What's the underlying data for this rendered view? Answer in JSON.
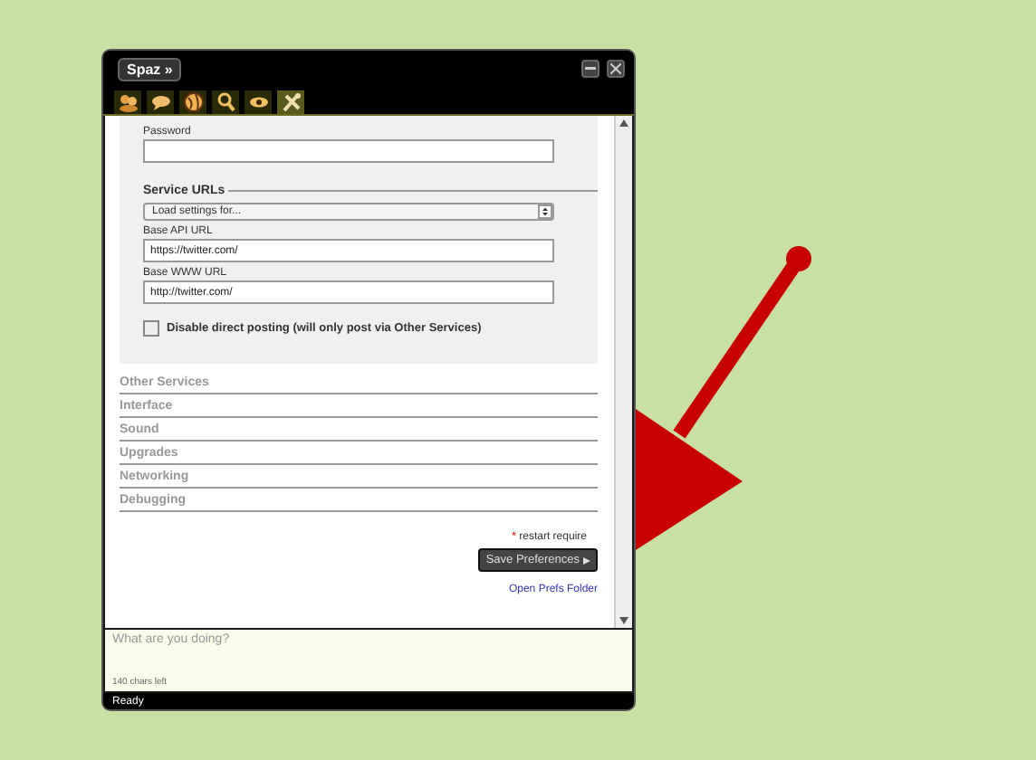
{
  "window": {
    "title": "Spaz »"
  },
  "tabs": [
    {
      "kind": "friends",
      "selected": false
    },
    {
      "kind": "replies",
      "selected": false
    },
    {
      "kind": "public",
      "selected": false
    },
    {
      "kind": "search",
      "selected": false
    },
    {
      "kind": "watch",
      "selected": false
    },
    {
      "kind": "settings",
      "selected": true
    }
  ],
  "account": {
    "password_label": "Password"
  },
  "service_urls": {
    "heading": "Service URLs",
    "select": "Load settings for...",
    "fields": [
      {
        "label": "Base API URL",
        "value": "https://twitter.com/"
      },
      {
        "label": "Base WWW URL",
        "value": "http://twitter.com/"
      }
    ],
    "checkbox": {
      "label": "Disable direct posting (will only post via Other Services)",
      "checked": false
    }
  },
  "sections": [
    "Other Services",
    "Interface",
    "Sound",
    "Upgrades",
    "Networking",
    "Debugging"
  ],
  "footer": {
    "note_mark": "*",
    "note": "restart require",
    "save_button": "Save Preferences",
    "prefs_link": "Open Prefs Folder"
  },
  "compose": {
    "placeholder": "What are you doing?",
    "counter": "140 chars left"
  },
  "status_bar": "Ready"
}
